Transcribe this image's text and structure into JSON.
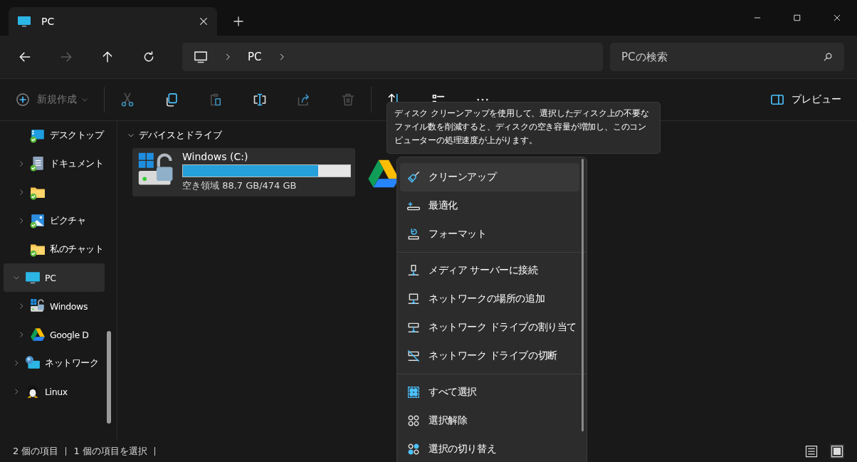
{
  "tabs": [
    {
      "title": "PC",
      "selected": true
    }
  ],
  "nav_buttons": [
    {
      "kind": "back",
      "disabled": false
    },
    {
      "kind": "forward",
      "disabled": true
    },
    {
      "kind": "up",
      "disabled": false
    },
    {
      "kind": "refresh",
      "disabled": false
    }
  ],
  "address": {
    "crumbs": [
      "PC"
    ],
    "search_placeholder": "PCの検索"
  },
  "toolbar": {
    "new_label": "新規作成",
    "actions": [
      {
        "kind": "cut",
        "disabled": true
      },
      {
        "kind": "copy",
        "disabled": false
      },
      {
        "kind": "paste",
        "disabled": true
      },
      {
        "kind": "rename",
        "disabled": false
      },
      {
        "kind": "share",
        "disabled": true
      },
      {
        "kind": "delete",
        "disabled": true
      }
    ],
    "preview_label": "プレビュー"
  },
  "sidebar": {
    "continued_children": [
      {
        "label": "デスクトップ",
        "kind": "desktop",
        "synced": true,
        "expandable": false
      },
      {
        "label": "ドキュメント",
        "kind": "document",
        "synced": true,
        "expandable": true
      },
      {
        "kind": "folder",
        "synced": true,
        "expandable": true
      },
      {
        "label": "ピクチャ",
        "kind": "pictures",
        "synced": true,
        "expandable": true
      },
      {
        "label": "私のチャット",
        "kind": "folder",
        "synced": true,
        "expandable": false
      }
    ],
    "items": [
      {
        "label": "PC",
        "kind": "pc",
        "expandable": true,
        "expanded": true,
        "selected": true,
        "children": [
          {
            "label": "Windows",
            "kind": "windows-drive",
            "expandable": true,
            "expanded": false,
            "selected": false
          },
          {
            "label": "Google D",
            "kind": "google-drive",
            "expandable": true,
            "expanded": false,
            "selected": false
          }
        ]
      },
      {
        "label": "ネットワーク",
        "kind": "network",
        "expandable": true,
        "expanded": false,
        "selected": false
      },
      {
        "label": "Linux",
        "kind": "linux",
        "expandable": true,
        "expanded": false,
        "selected": false
      }
    ]
  },
  "section": {
    "title": "デバイスとドライブ",
    "expanded": true,
    "drives": [
      {
        "kind": "windows-drive",
        "name": "Windows (C:)",
        "level": 0.81,
        "free": "空き領域 88.7 GB/474 GB",
        "hovered": true
      },
      {
        "kind": "google-drive",
        "hovered": false
      }
    ]
  },
  "tooltip": "ディスク クリーンアップを使用して、選択したディスク上の不要なファイル数を削減すると、ディスクの空き容量が増加し、このコンピューターの処理速度が上がります。",
  "context_menu": {
    "groups": [
      [
        {
          "kind": "broom",
          "label": "クリーンアップ",
          "selected": true
        },
        {
          "kind": "optimize",
          "label": "最適化",
          "selected": false
        },
        {
          "kind": "format",
          "label": "フォーマット",
          "selected": false
        }
      ],
      [
        {
          "kind": "media",
          "label": "メディア サーバーに接続",
          "selected": false
        },
        {
          "kind": "net-add",
          "label": "ネットワークの場所の追加",
          "selected": false
        },
        {
          "kind": "net-map",
          "label": "ネットワーク ドライブの割り当て",
          "selected": false
        },
        {
          "kind": "net-dis",
          "label": "ネットワーク ドライブの切断",
          "selected": false
        }
      ],
      [
        {
          "kind": "select-all",
          "label": "すべて選択",
          "selected": false
        },
        {
          "kind": "select-none",
          "label": "選択解除",
          "selected": false
        },
        {
          "kind": "invert",
          "label": "選択の切り替え",
          "selected": false
        }
      ]
    ]
  },
  "status_bar": {
    "item_count": "2 個の項目",
    "selection": "1 個の項目を選択",
    "views": [
      {
        "kind": "details",
        "selected": false
      },
      {
        "kind": "tiles",
        "selected": true
      }
    ]
  }
}
